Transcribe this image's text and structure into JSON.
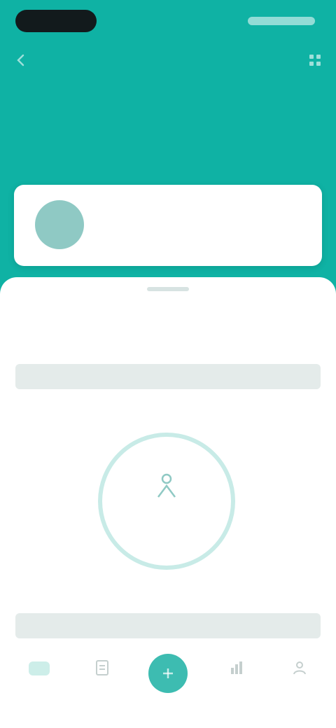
{
  "header": {
    "title": "",
    "subtitle": "",
    "colors": {
      "accent": "#0fb2a4"
    },
    "back_icon": "back-arrow-icon",
    "menu_icon": "grid-menu-icon"
  },
  "profile_card": {
    "name": "",
    "detail": "",
    "link": ""
  },
  "main": {
    "section_title": "",
    "banner_text": "",
    "hint": "",
    "ring_value": "",
    "left_label": "",
    "right_label": "",
    "bottom_banner_text": ""
  },
  "tabbar": {
    "tabs": [
      {
        "label": "",
        "icon": "home-icon"
      },
      {
        "label": "",
        "icon": "document-icon"
      },
      {
        "label": "",
        "icon": "add-icon"
      },
      {
        "label": "",
        "icon": "chart-icon"
      },
      {
        "label": "",
        "icon": "profile-icon"
      }
    ]
  }
}
